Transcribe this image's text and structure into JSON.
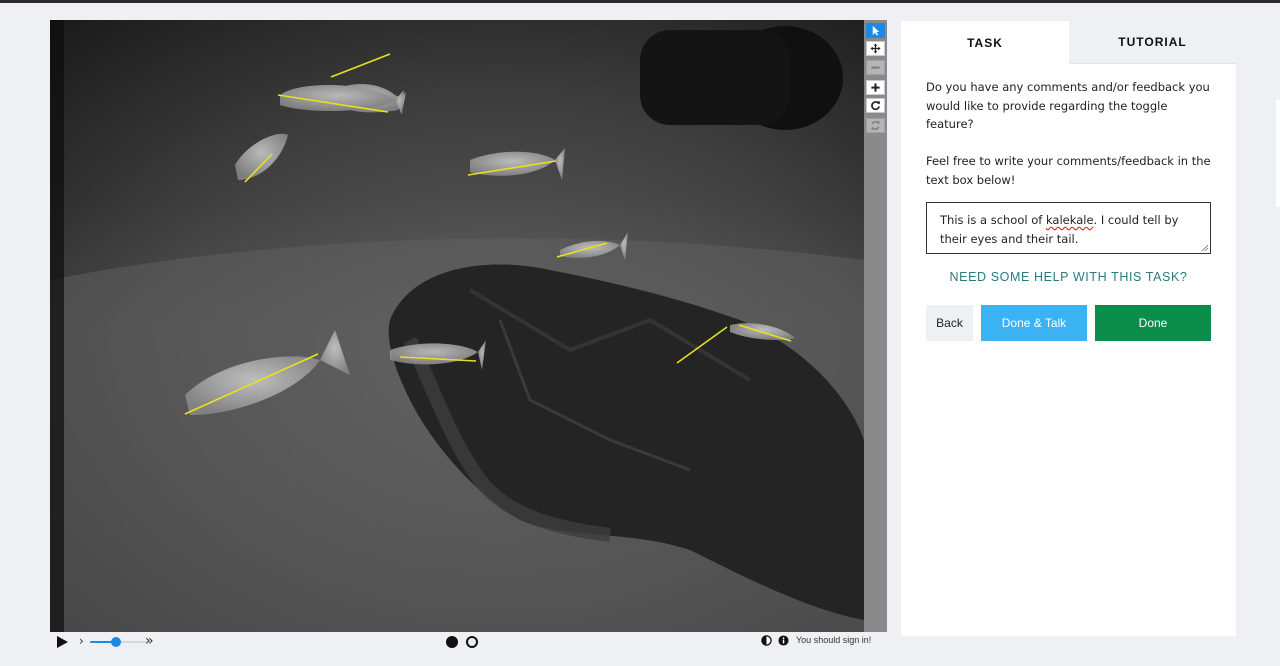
{
  "viewer": {
    "image_description_name": "underwater-camera-frame"
  },
  "toolbar": {
    "tools": [
      {
        "name": "pointer-tool",
        "icon": "pointer-icon",
        "state": "active"
      },
      {
        "name": "pan-tool",
        "icon": "move-icon",
        "state": "normal"
      },
      {
        "name": "zoom-out-tool",
        "icon": "minus-icon",
        "state": "disabled"
      },
      {
        "name": "zoom-in-tool",
        "icon": "plus-icon",
        "state": "normal"
      },
      {
        "name": "rotate-tool",
        "icon": "rotate-icon",
        "state": "normal"
      },
      {
        "name": "reset-tool",
        "icon": "refresh-icon",
        "state": "disabled"
      }
    ]
  },
  "playback": {
    "speed_level": 0.45,
    "frames": [
      {
        "name": "frame-1",
        "selected": true
      },
      {
        "name": "frame-2",
        "selected": false
      }
    ],
    "signin_text": "You should sign in!"
  },
  "panel": {
    "tabs": {
      "task": "TASK",
      "tutorial": "TUTORIAL"
    },
    "question_1": "Do you have any comments and/or feedback you would like to provide regarding the toggle feature?",
    "question_2": "Feel free to write your comments/feedback in the text box below!",
    "comment": {
      "before": "This is a school of ",
      "misspelled": "kalekale",
      "after": ". I could tell by their eyes and their tail."
    },
    "help_link": "NEED SOME HELP WITH THIS TASK?",
    "buttons": {
      "back": "Back",
      "done_talk": "Done & Talk",
      "done": "Done"
    }
  },
  "colors": {
    "accent_blue": "#1e88e5",
    "talk_button": "#3bb2f4",
    "done_button": "#0b8d4b",
    "help_link": "#2a7b80",
    "annotation_line": "#e8e020"
  }
}
